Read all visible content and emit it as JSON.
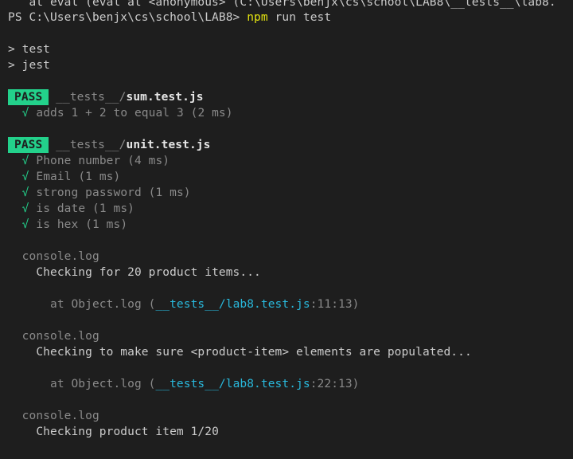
{
  "terminal": {
    "top_partial": "   at eval (eval at <anonymous> (C:\\Users\\benjx\\cs\\school\\LAB8\\__tests__\\lab8.",
    "prompt": {
      "path": "PS C:\\Users\\benjx\\cs\\school\\LAB8> ",
      "command_npm": "npm",
      "command_rest": " run test"
    },
    "script_lines": [
      "> test",
      "> jest"
    ],
    "suites": [
      {
        "status": "PASS",
        "dir": "__tests__/",
        "file": "sum.test.js",
        "tests": [
          {
            "check": "√",
            "text": "adds 1 + 2 to equal 3 (2 ms)"
          }
        ]
      },
      {
        "status": "PASS",
        "dir": "__tests__/",
        "file": "unit.test.js",
        "tests": [
          {
            "check": "√",
            "text": "Phone number (4 ms)"
          },
          {
            "check": "√",
            "text": "Email (1 ms)"
          },
          {
            "check": "√",
            "text": "strong password (1 ms)"
          },
          {
            "check": "√",
            "text": "is date (1 ms)"
          },
          {
            "check": "√",
            "text": "is hex (1 ms)"
          }
        ]
      }
    ],
    "console_logs": [
      {
        "header": "console.log",
        "message": "Checking for 20 product items...",
        "at_prefix": "at Object.log (",
        "at_file": "__tests__/lab8.test.js",
        "at_loc": ":11:13)"
      },
      {
        "header": "console.log",
        "message": "Checking to make sure <product-item> elements are populated...",
        "at_prefix": "at Object.log (",
        "at_file": "__tests__/lab8.test.js",
        "at_loc": ":22:13)"
      },
      {
        "header": "console.log",
        "message": "Checking product item 1/20"
      }
    ],
    "colors": {
      "background": "#1e1e1e",
      "pass_badge": "#23d18b",
      "check": "#23d18b",
      "npm": "#e5e510",
      "file_link": "#29b8db"
    }
  }
}
